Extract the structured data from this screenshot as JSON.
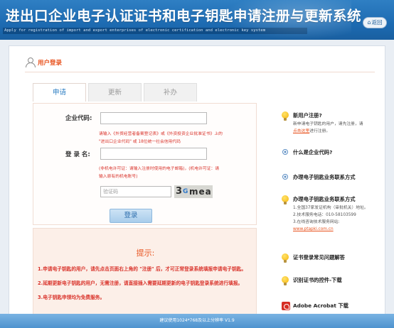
{
  "header": {
    "title": "进出口企业电子认证证书和电子钥匙申请注册与更新系统",
    "subtitle": "Apply for registration of import and export enterprises of electronic certification and electronic key system",
    "back_label": "返回"
  },
  "login": {
    "title": "用户登录",
    "tabs": [
      "申请",
      "更新",
      "补办"
    ],
    "active_tab": "申请",
    "company_code_label": "企业代码:",
    "company_code_value": "",
    "company_hint_1": "请输入《外贸经营者备案登记表》或《外资投资企业批准证书》上的",
    "company_hint_2": "\"进出口企业代码\" 或 18位统一社会信用代码",
    "login_name_label": "登 录 名:",
    "login_name_value": "",
    "login_hint_1": "(非机电许可证：请输入注册时使用的电子邮箱)，(机电许可证：请",
    "login_hint_2": "输入原有的机电账号)",
    "captcha_placeholder": "验证码",
    "captcha_text": "3Gmea",
    "login_button": "登录"
  },
  "tips": {
    "title": "提示:",
    "lines": [
      "1.申请电子钥匙的用户，请先点击页面右上角的 \"注册\" 后，才可正常登录系统填报申请电子钥匙。",
      "2.延期更新电子钥匙的用户，无需注册，请直接插入需要延期更新的电子钥匙登录系统进行填报。",
      "3.电子钥匙申领均为免费服务。"
    ]
  },
  "sidebar": {
    "new_user_title": "新用户注册?",
    "new_user_text_1": "新申请电子钥匙的用户，请先注册，请",
    "new_user_link": "点击这里",
    "new_user_text_2": "进行注册。",
    "company_code_q": "什么是企业代码?",
    "contact_1": "办理电子钥匙业务联系方式",
    "contact_2": "办理电子钥匙业务联系方式",
    "contact_lines": [
      "1.全国37家发证机构（审批机关）地址。",
      "2.技术服务电话：010-58103599",
      "3.在线咨询技术服务网站:"
    ],
    "website": "www.ptapki.com.cn",
    "faq": "证书登录常见问题解答",
    "identify": "识别证书的控件-下载",
    "adobe": "Adobe Acrobat 下载"
  },
  "footer": {
    "text": "建议使用1024*768及以上分辨率 V1.9"
  }
}
